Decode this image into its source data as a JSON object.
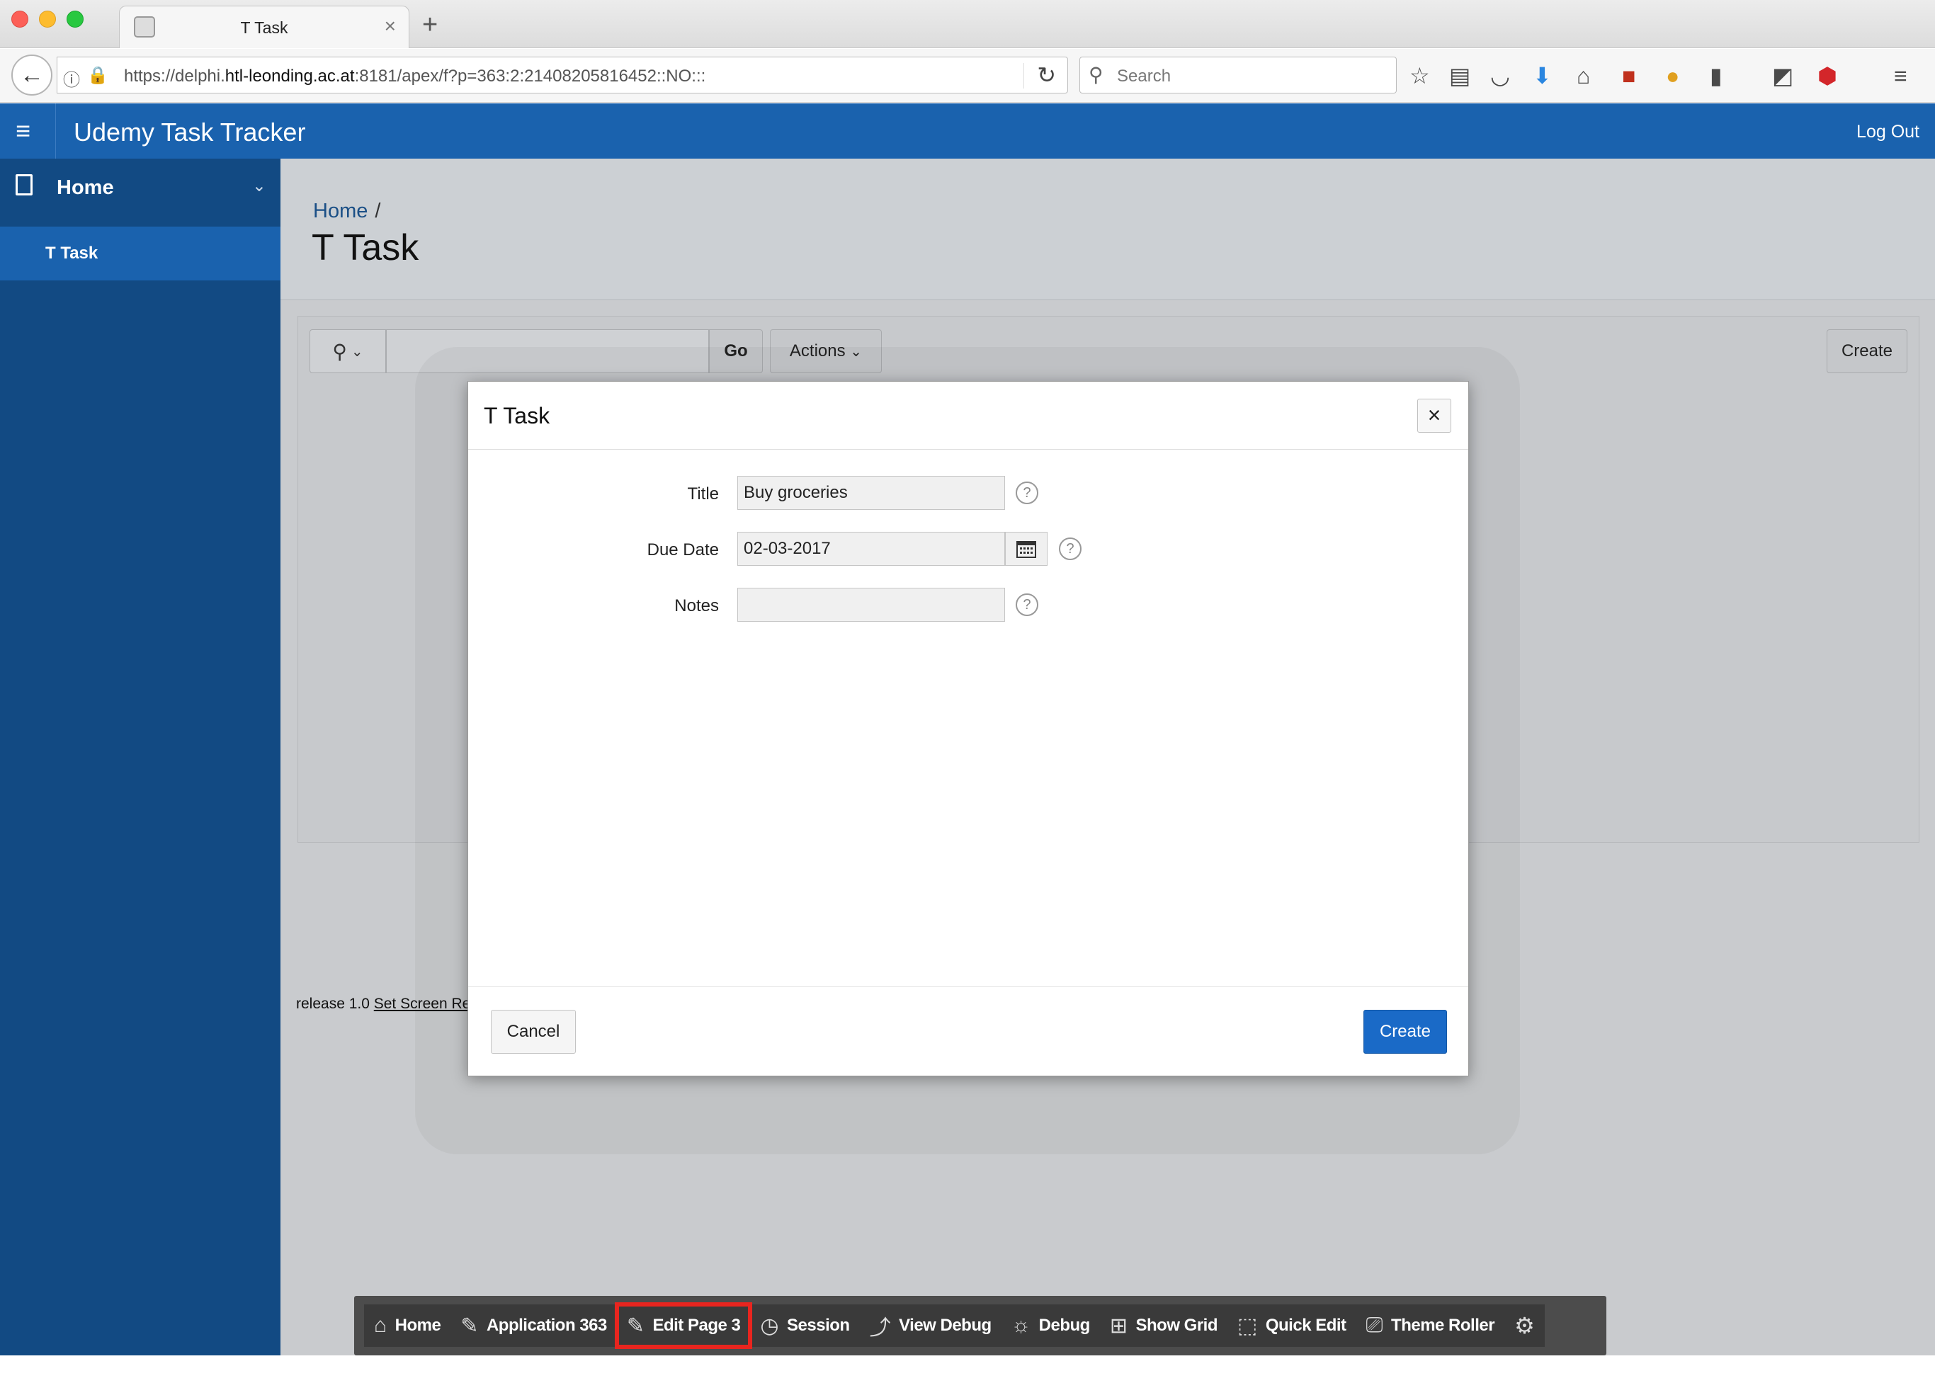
{
  "browser": {
    "tab_title": "T Task",
    "url_prefix": "https://delphi.",
    "url_host": "htl-leonding.ac.at",
    "url_rest": ":8181/apex/f?p=363:2:21408205816452::NO:::",
    "search_placeholder": "Search",
    "new_tab_symbol": "+",
    "tab_close_symbol": "×",
    "toolbar_icons": [
      "star-icon",
      "reading-list-icon",
      "pocket-icon",
      "download-icon",
      "home-icon",
      "extension-icon",
      "color-icon",
      "clipboard-icon",
      "screenshot-icon",
      "adblock-icon",
      "menu-icon"
    ]
  },
  "header": {
    "app_title": "Udemy Task Tracker",
    "logout_label": "Log Out"
  },
  "sidebar": {
    "items": [
      {
        "label": "Home"
      },
      {
        "label": "T Task"
      }
    ]
  },
  "page": {
    "breadcrumb_home": "Home",
    "breadcrumb_sep": "/",
    "title": "T Task"
  },
  "report": {
    "go_label": "Go",
    "actions_label": "Actions",
    "create_label": "Create"
  },
  "footer": {
    "release": "release 1.0 ",
    "screen_reader_link": "Set Screen Re"
  },
  "dialog": {
    "title": "T Task",
    "close_symbol": "×",
    "fields": {
      "title_label": "Title",
      "title_value": "Buy groceries",
      "due_label": "Due Date",
      "due_value": "02-03-2017",
      "notes_label": "Notes",
      "notes_value": ""
    },
    "help_symbol": "?",
    "cancel_label": "Cancel",
    "create_label": "Create"
  },
  "dev_toolbar": {
    "items": [
      {
        "label": "Home",
        "icon": "home-icon"
      },
      {
        "label": "Application 363",
        "icon": "edit-icon"
      },
      {
        "label": "Edit Page 3",
        "icon": "edit-icon",
        "highlighted": true
      },
      {
        "label": "Session",
        "icon": "clock-icon"
      },
      {
        "label": "View Debug",
        "icon": "debug-view-icon"
      },
      {
        "label": "Debug",
        "icon": "bug-icon"
      },
      {
        "label": "Show Grid",
        "icon": "grid-icon"
      },
      {
        "label": "Quick Edit",
        "icon": "cursor-icon"
      },
      {
        "label": "Theme Roller",
        "icon": "paint-roller-icon"
      }
    ],
    "highlight_color": "#e8251f"
  },
  "colors": {
    "header_blue": "#1a62ae",
    "sidebar_blue": "#124a83",
    "primary_button": "#1a6ac7"
  }
}
